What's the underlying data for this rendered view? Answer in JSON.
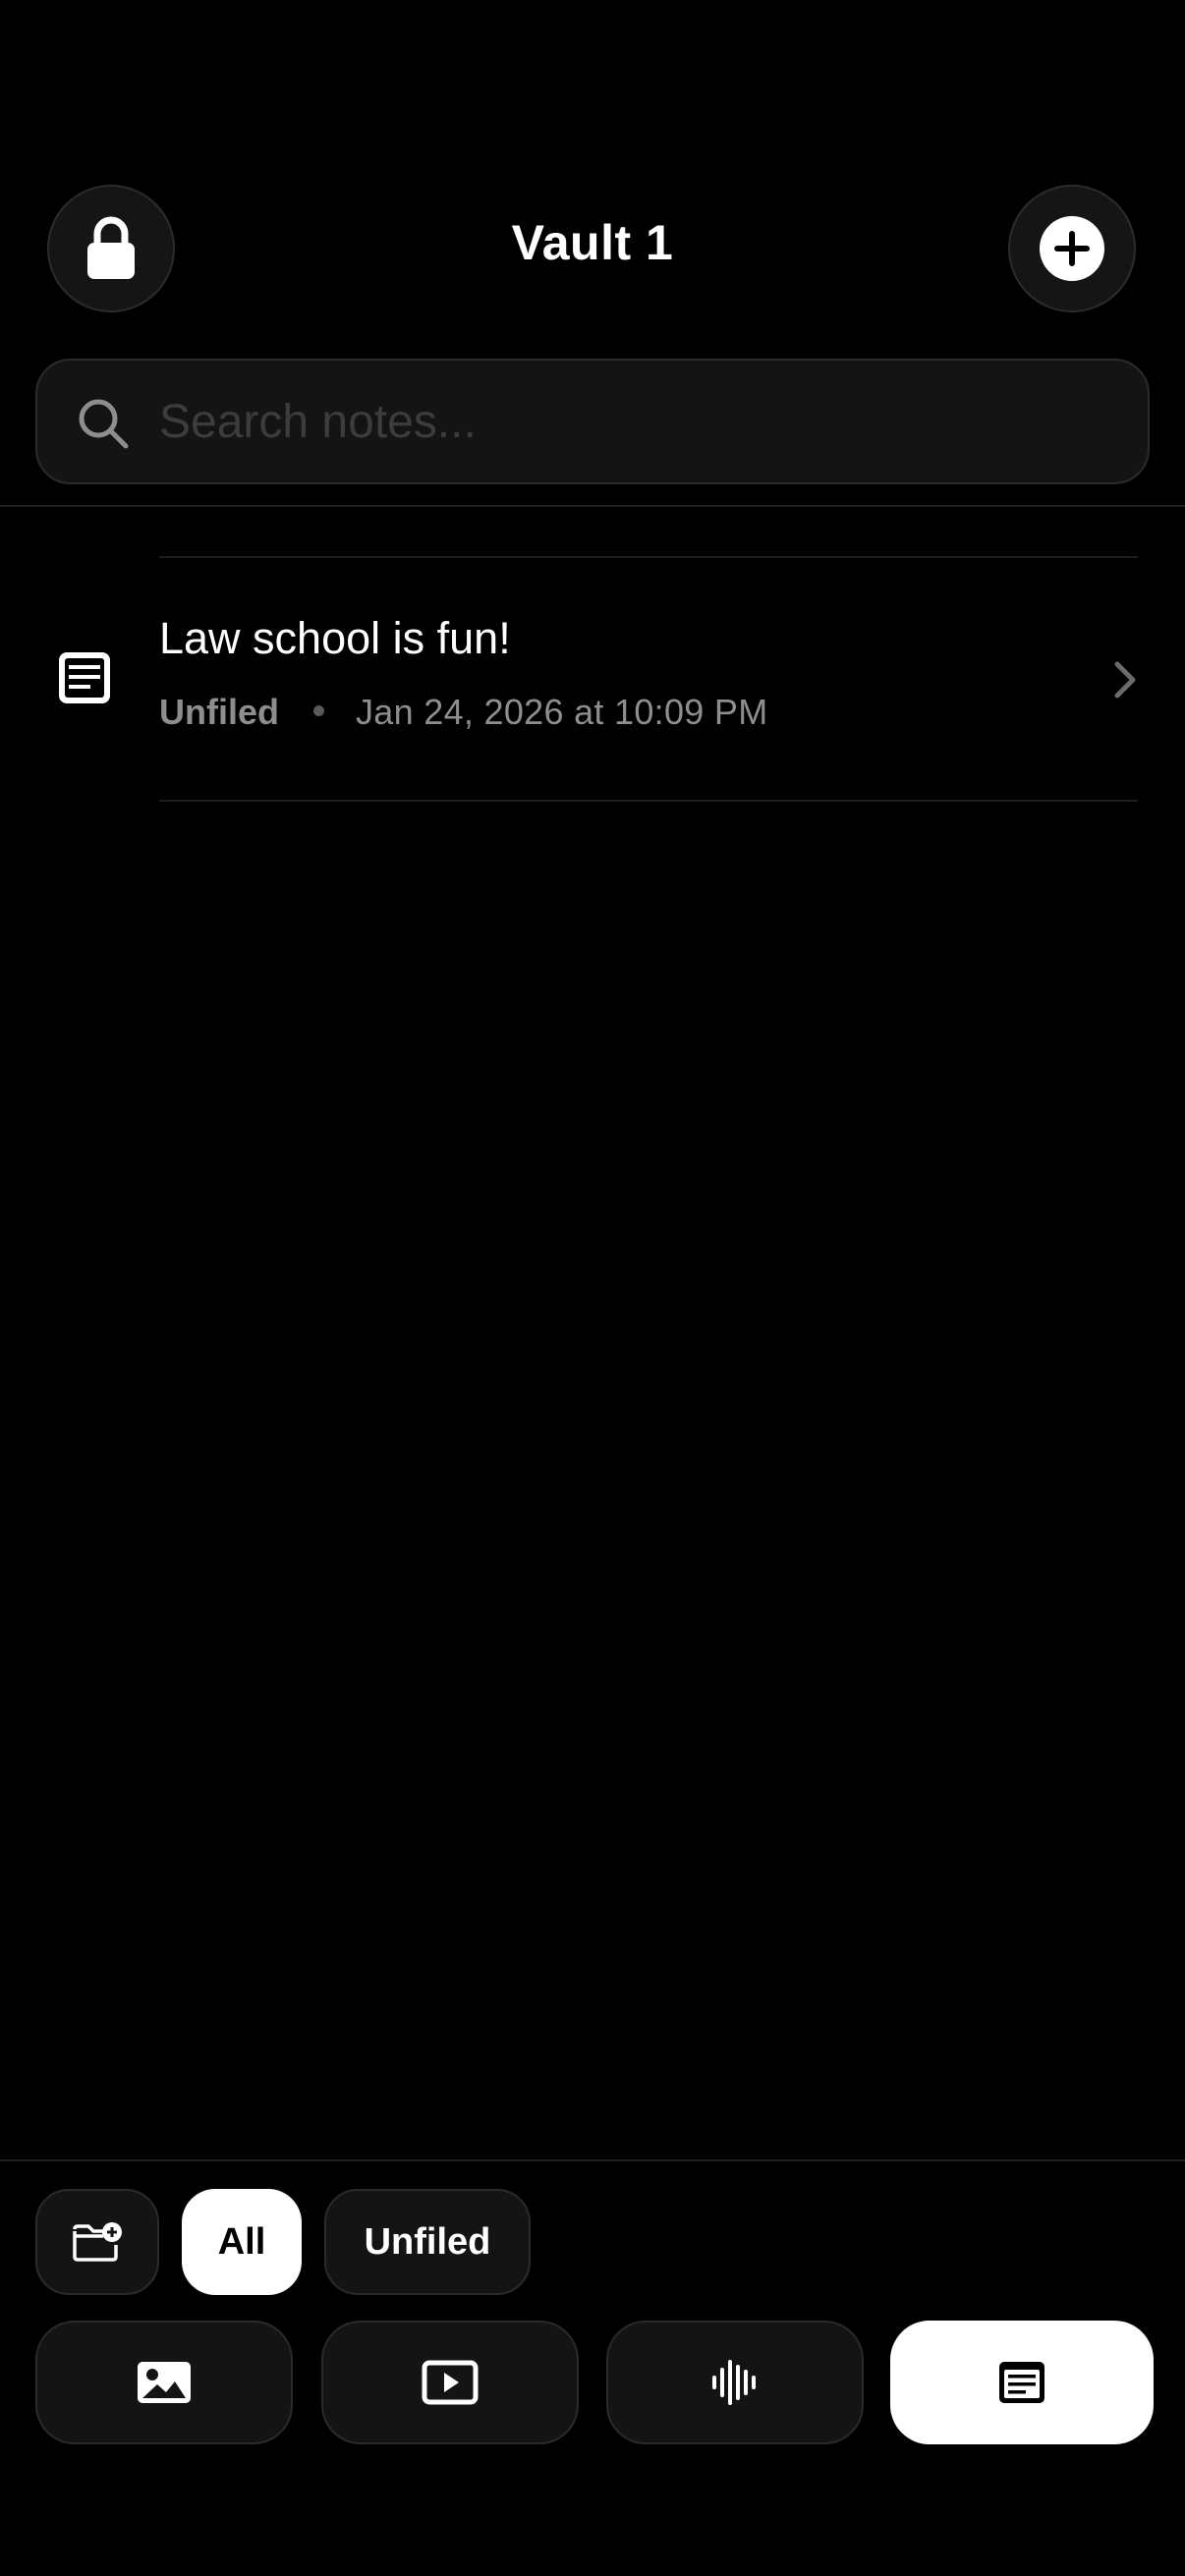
{
  "header": {
    "title": "Vault 1",
    "lock_icon": "lock-icon",
    "add_icon": "plus-circle-icon"
  },
  "search": {
    "placeholder": "Search notes...",
    "value": "",
    "icon": "search-icon"
  },
  "notes": [
    {
      "title": "Law school is fun!",
      "folder": "Unfiled",
      "date": "Jan 24, 2026 at 10:09 PM",
      "icon": "note-icon"
    }
  ],
  "filters": {
    "new_folder_icon": "folder-plus-icon",
    "items": [
      {
        "label": "All",
        "selected": true
      },
      {
        "label": "Unfiled",
        "selected": false
      }
    ]
  },
  "type_tabs": [
    {
      "icon": "image-icon",
      "selected": false
    },
    {
      "icon": "video-icon",
      "selected": false
    },
    {
      "icon": "waveform-icon",
      "selected": false
    },
    {
      "icon": "note-icon",
      "selected": true
    }
  ],
  "colors": {
    "background": "#000000",
    "surface": "#141414",
    "border": "#2b2b2b",
    "text_primary": "#ffffff",
    "text_secondary": "#8e8e8e",
    "selected": "#ffffff"
  }
}
